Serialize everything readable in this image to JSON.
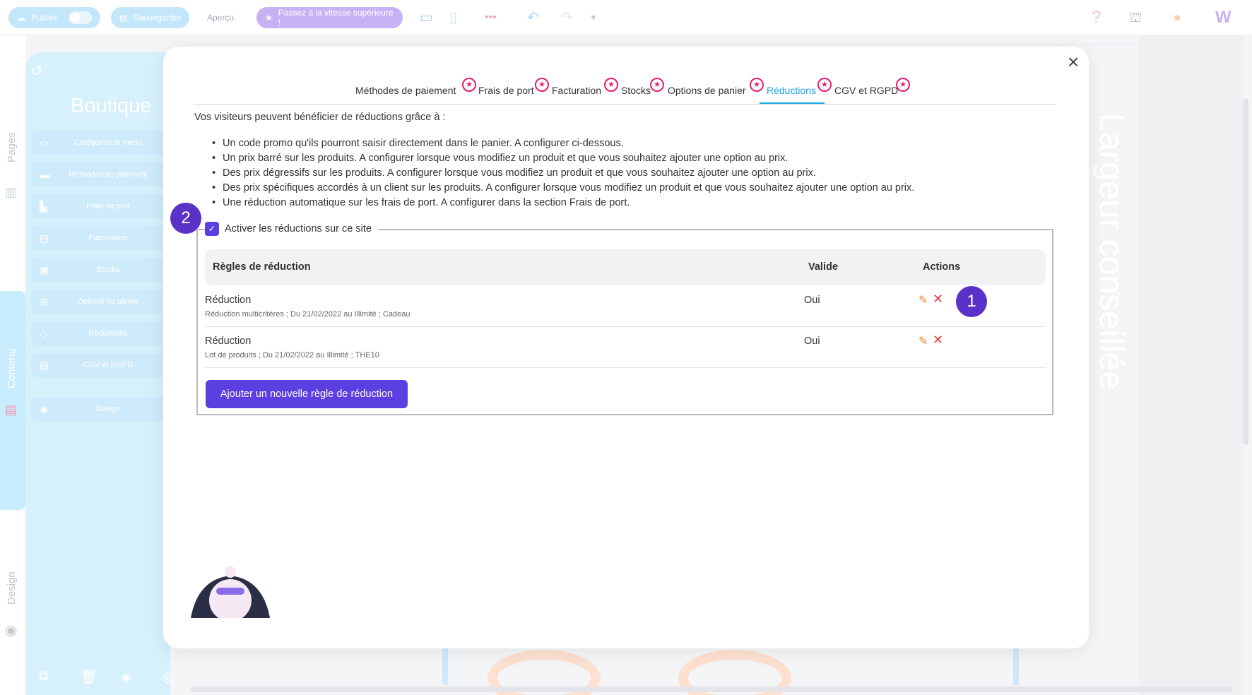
{
  "topbar": {
    "publish_label": "Publier",
    "save_label": "Sauvegarder",
    "preview_label": "Aperçu",
    "upgrade_label": "Passez à la vitesse supérieure !"
  },
  "rail": {
    "pages_label": "Pages",
    "content_label": "Contenu",
    "design_label": "Design"
  },
  "sidebar": {
    "title": "Boutique",
    "items": [
      {
        "label": "Catégories et menu"
      },
      {
        "label": "Méthodes de paiement"
      },
      {
        "label": "Frais de port"
      },
      {
        "label": "Facturation"
      },
      {
        "label": "Stocks"
      },
      {
        "label": "Options de panier"
      },
      {
        "label": "Réductions"
      },
      {
        "label": "CGV et RGPD"
      },
      {
        "label": "Design"
      }
    ]
  },
  "canvas": {
    "ghost_text": "Largeur conseillée"
  },
  "modal": {
    "close_glyph": "×",
    "tabs": [
      {
        "label": "Méthodes de paiement"
      },
      {
        "label": "Frais de port"
      },
      {
        "label": "Facturation"
      },
      {
        "label": "Stocks"
      },
      {
        "label": "Options de panier"
      },
      {
        "label": "Réductions"
      },
      {
        "label": "CGV et RGPD"
      }
    ],
    "active_tab": "Réductions",
    "intro": "Vos visiteurs peuvent bénéficier de réductions grâce à :",
    "bullets": [
      "Un code promo qu'ils pourront saisir directement dans le panier. A configurer ci-dessous.",
      "Un prix barré sur les produits. A configurer lorsque vous modifiez un produit et que vous souhaitez ajouter une option au prix.",
      "Des prix dégressifs sur les produits. A configurer lorsque vous modifiez un produit et que vous souhaitez ajouter une option au prix.",
      "Des prix spécifiques accordés à un client sur les produits. A configurer lorsque vous modifiez un produit et que vous souhaitez ajouter une option au prix.",
      "Une réduction automatique sur les frais de port. A configurer dans la section Frais de port."
    ],
    "activate_label": "Activer les réductions sur ce site",
    "activate_checked": true,
    "table": {
      "headers": {
        "rules": "Règles de réduction",
        "valid": "Valide",
        "actions": "Actions"
      },
      "rows": [
        {
          "title": "Réduction",
          "subtitle": "Réduction multicritères ; Du 21/02/2022 au Illimité ; Cadeau",
          "valid": "Oui"
        },
        {
          "title": "Réduction",
          "subtitle": "Lot de produits ; Du 21/02/2022 au Illimité ; THE10",
          "valid": "Oui"
        }
      ]
    },
    "add_button_label": "Ajouter un nouvelle règle de réduction"
  },
  "annotations": {
    "badge_1": "1",
    "badge_2": "2"
  },
  "colors": {
    "accent": "#5b3fe0",
    "tab_active": "#1fa8e0",
    "badge": "#5a32c8",
    "star": "#e61d73"
  }
}
